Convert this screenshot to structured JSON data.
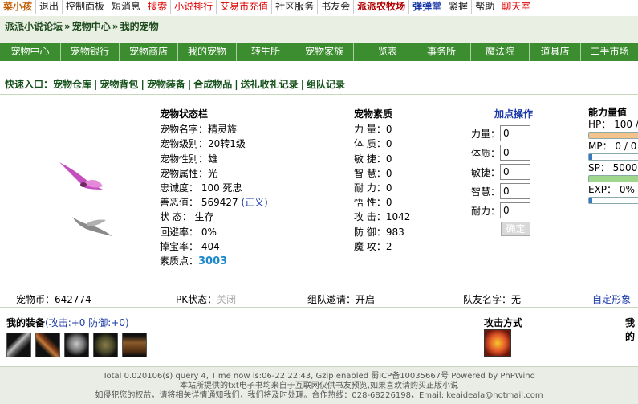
{
  "topbar": {
    "items": [
      {
        "label": "菜小孩",
        "style": "orange"
      },
      {
        "label": "退出",
        "style": "plain"
      },
      {
        "label": "控制面板",
        "style": "plain"
      },
      {
        "label": "短消息",
        "style": "plain"
      },
      {
        "label": "搜索",
        "style": "red"
      },
      {
        "label": "小说排行",
        "style": "red"
      },
      {
        "label": "艾易市充值",
        "style": "red"
      },
      {
        "label": "社区服务",
        "style": "plain"
      },
      {
        "label": "书友会",
        "style": "plain"
      },
      {
        "label": "派派农牧场",
        "style": "darkred"
      },
      {
        "label": "弹弹堂",
        "style": "blue"
      },
      {
        "label": "紧握",
        "style": "plain"
      },
      {
        "label": "帮助",
        "style": "plain"
      },
      {
        "label": "聊天室",
        "style": "red"
      }
    ]
  },
  "breadcrumb": {
    "site": "派派小说论坛",
    "sep": "»",
    "section": "宠物中心",
    "sep2": "»",
    "page": "我的宠物"
  },
  "nav": [
    "宠物中心",
    "宠物银行",
    "宠物商店",
    "我的宠物",
    "转生所",
    "宠物家族",
    "一览表",
    "事务所",
    "魔法院",
    "道具店",
    "二手市场"
  ],
  "quick": {
    "label": "快速入口：",
    "links": [
      "宠物仓库",
      "宠物背包",
      "宠物装备",
      "合成物品",
      "送礼收礼记录",
      "组队记录"
    ]
  },
  "status": {
    "heading": "宠物状态栏",
    "rows": [
      "宠物名字：精灵族",
      "宠物级别：20转1级",
      "宠物性别：雄",
      "宠物属性：光",
      "忠诚度：  100 死忠",
      "善恶值：  569427",
      "状   态：  生存",
      "回避率：  0%",
      "掉宝率：  404",
      "素质点："
    ],
    "justice": "(正义)",
    "points": "3003"
  },
  "attrs": {
    "heading": "宠物素质",
    "rows": [
      "力  量：0",
      "体  质：0",
      "敏  捷：0",
      "智  慧：0",
      "耐  力：0",
      "悟  性：0",
      "攻  击：1042",
      "防  御：983",
      "魔  攻：2"
    ]
  },
  "addop": {
    "heading": "加点操作",
    "fields": [
      {
        "label": "力量：",
        "value": "0"
      },
      {
        "label": "体质：",
        "value": "0"
      },
      {
        "label": "敏捷：",
        "value": "0"
      },
      {
        "label": "智慧：",
        "value": "0"
      },
      {
        "label": "耐力：",
        "value": "0"
      }
    ],
    "confirm": "确定"
  },
  "ability": {
    "heading": "能力量值",
    "hp": "HP： 100 /",
    "mp": "MP： 0 / 0",
    "sp": "SP： 5000",
    "exp": "EXP： 0%"
  },
  "info": {
    "coins": "宠物币：642774",
    "pk_label": "PK状态：",
    "pk_value": "关闭",
    "team": "组队邀请：开启",
    "friend": "队友名字：无",
    "custom": "自定形象"
  },
  "equip": {
    "label": "我的装备",
    "stat": "(攻击:+0 防御:+0)"
  },
  "attack": {
    "label": "攻击方式"
  },
  "myname": {
    "label": "我的"
  },
  "footer": {
    "line1": "Total 0.020106(s) query 4, Time now is:06-22 22:43, Gzip enabled 蜀ICP备10035667号 Powered by PhPWind",
    "line2": "本站所提供的txt电子书均来自于互联网仅供书友预览,如果喜欢请购买正版小说",
    "line3": "如侵犯您的权益，请将相关详情通知我们，我们将及时处理。合作热线：028-68226198，Email: keaideala@hotmail.com"
  },
  "colors": {
    "nav": "#3c8d2f",
    "accent": "#1b3aa8",
    "points": "#1c87c9"
  }
}
